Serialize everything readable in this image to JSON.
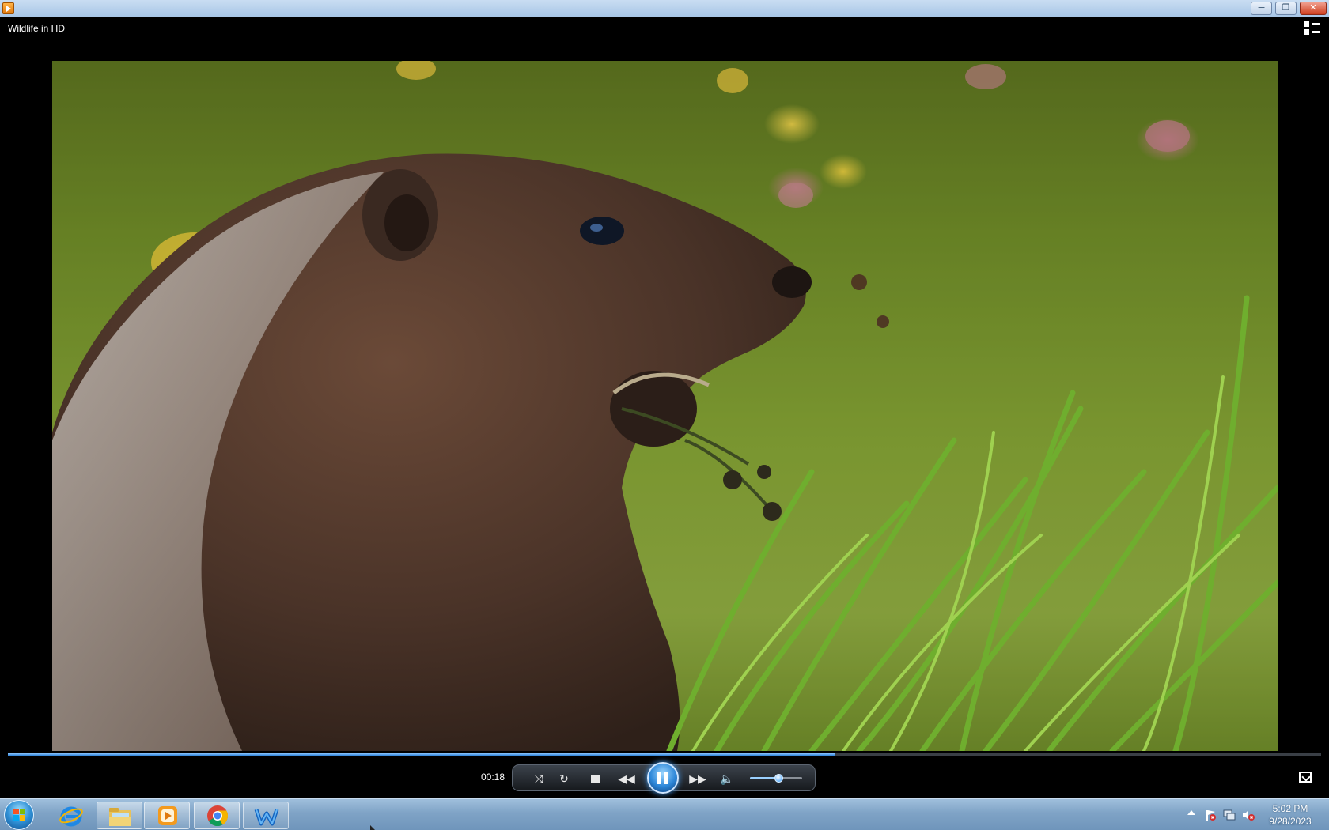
{
  "window": {
    "minimize_glyph": "─",
    "restore_glyph": "❐",
    "close_glyph": "✕"
  },
  "player": {
    "title": "Wildlife in HD",
    "elapsed": "00:18",
    "seek_progress_percent": 63,
    "volume_percent": 55,
    "state": "playing"
  },
  "controls": {
    "shuffle_icon": "shuffle-icon",
    "repeat_icon": "repeat-icon",
    "stop_icon": "stop-icon",
    "previous_icon": "rewind-icon",
    "play_pause_icon": "pause-icon",
    "next_icon": "fast-forward-icon",
    "mute_icon": "speaker-icon",
    "fullscreen_icon": "fullscreen-icon",
    "switch_view_icon": "switch-to-library-icon",
    "shuffle_glyph": "⤨",
    "repeat_glyph": "↻",
    "previous_glyph": "◀◀",
    "next_glyph": "▶▶",
    "mute_glyph": "🔈"
  },
  "taskbar": {
    "pinned": [
      "internet-explorer-icon",
      "windows-explorer-icon",
      "windows-media-player-icon",
      "chrome-icon",
      "app-w-icon"
    ],
    "clock_time": "5:02 PM",
    "clock_date": "9/28/2023"
  },
  "colors": {
    "accent": "#2a7fd6",
    "titlebar": "#b9d1ec",
    "taskbar": "#7fa3c6"
  }
}
